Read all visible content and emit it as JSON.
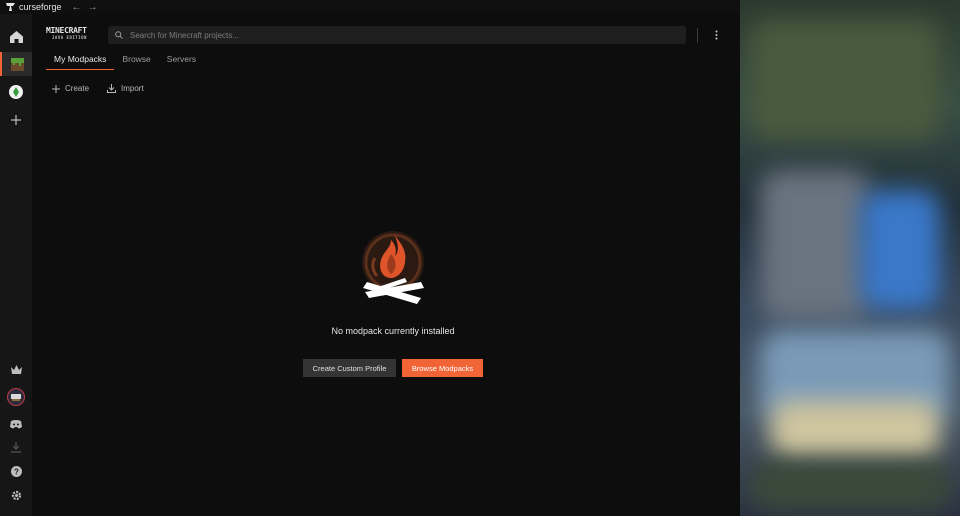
{
  "titlebar": {
    "app_name": "curseforge"
  },
  "header": {
    "game_logo_line1": "MINECRAFT",
    "game_logo_line2": "JAVA EDITION",
    "search_placeholder": "Search for Minecraft projects..."
  },
  "tabs": [
    {
      "label": "My Modpacks",
      "active": true
    },
    {
      "label": "Browse",
      "active": false
    },
    {
      "label": "Servers",
      "active": false
    }
  ],
  "actions": {
    "create_label": "Create",
    "import_label": "Import"
  },
  "empty_state": {
    "message": "No modpack currently installed",
    "create_custom_label": "Create Custom Profile",
    "browse_label": "Browse Modpacks"
  },
  "rail": {
    "top_icons": [
      "home-icon",
      "minecraft-grass-icon",
      "game-icon",
      "plus-icon"
    ],
    "bottom_icons": [
      "crown-icon",
      "avatar",
      "discord-icon",
      "download-icon",
      "help-icon",
      "settings-icon"
    ]
  },
  "colors": {
    "accent": "#f16436",
    "background": "#0d0d0d",
    "rail": "#161616"
  }
}
